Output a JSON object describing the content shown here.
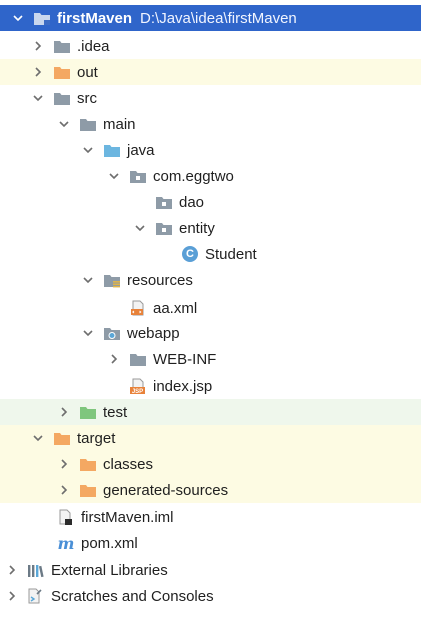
{
  "project": {
    "name": "firstMaven",
    "path": "D:\\Java\\idea\\firstMaven"
  },
  "nodes": [
    {
      "label": ".idea"
    },
    {
      "label": "out"
    },
    {
      "label": "src"
    },
    {
      "label": "main"
    },
    {
      "label": "java"
    },
    {
      "label": "com.eggtwo"
    },
    {
      "label": "dao"
    },
    {
      "label": "entity"
    },
    {
      "label": "Student"
    },
    {
      "label": "resources"
    },
    {
      "label": "aa.xml"
    },
    {
      "label": "webapp"
    },
    {
      "label": "WEB-INF"
    },
    {
      "label": "index.jsp"
    },
    {
      "label": "test"
    },
    {
      "label": "target"
    },
    {
      "label": "classes"
    },
    {
      "label": "generated-sources"
    },
    {
      "label": "firstMaven.iml"
    },
    {
      "label": "pom.xml"
    },
    {
      "label": "External Libraries"
    },
    {
      "label": "Scratches and Consoles"
    }
  ],
  "colors": {
    "selection": "#2f65ca",
    "folder_gray": "#8e9ba7",
    "folder_orange": "#f4a862",
    "folder_blue": "#6cb6e0",
    "folder_green": "#7fc67d",
    "highlight_yellow": "#fdfbe3",
    "highlight_green": "#eff7ec"
  }
}
